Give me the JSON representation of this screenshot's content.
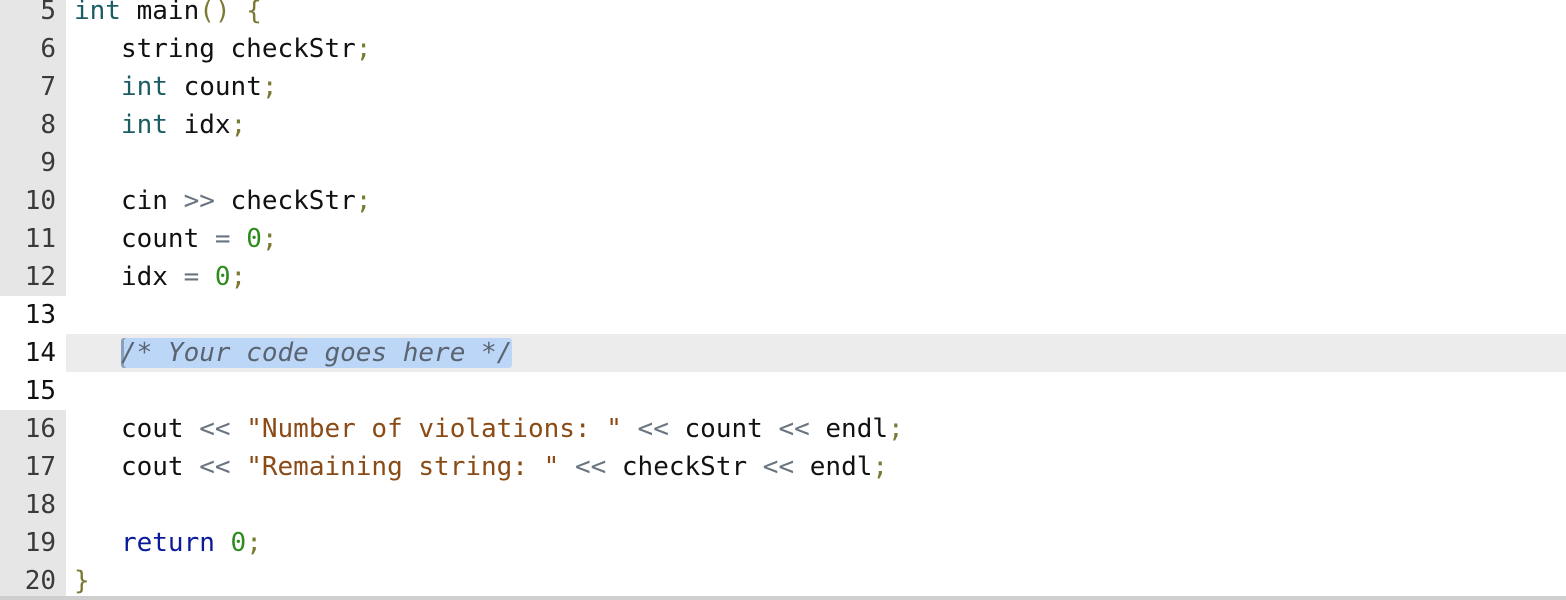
{
  "editor": {
    "lines": [
      {
        "number": "5",
        "mode": "readonly",
        "tokens": [
          {
            "t": "kw",
            "v": "int"
          },
          {
            "t": "id",
            "v": " main"
          },
          {
            "t": "punc",
            "v": "()"
          },
          {
            "t": "id",
            "v": " "
          },
          {
            "t": "punc",
            "v": "{"
          }
        ]
      },
      {
        "number": "6",
        "mode": "readonly",
        "tokens": [
          {
            "t": "id",
            "v": "   string checkStr"
          },
          {
            "t": "punc",
            "v": ";"
          }
        ]
      },
      {
        "number": "7",
        "mode": "readonly",
        "tokens": [
          {
            "t": "id",
            "v": "   "
          },
          {
            "t": "kw",
            "v": "int"
          },
          {
            "t": "id",
            "v": " count"
          },
          {
            "t": "punc",
            "v": ";"
          }
        ]
      },
      {
        "number": "8",
        "mode": "readonly",
        "tokens": [
          {
            "t": "id",
            "v": "   "
          },
          {
            "t": "kw",
            "v": "int"
          },
          {
            "t": "id",
            "v": " idx"
          },
          {
            "t": "punc",
            "v": ";"
          }
        ]
      },
      {
        "number": "9",
        "mode": "readonly",
        "tokens": []
      },
      {
        "number": "10",
        "mode": "readonly",
        "tokens": [
          {
            "t": "id",
            "v": "   cin "
          },
          {
            "t": "op",
            "v": ">>"
          },
          {
            "t": "id",
            "v": " checkStr"
          },
          {
            "t": "punc",
            "v": ";"
          }
        ]
      },
      {
        "number": "11",
        "mode": "readonly",
        "tokens": [
          {
            "t": "id",
            "v": "   count "
          },
          {
            "t": "op",
            "v": "="
          },
          {
            "t": "id",
            "v": " "
          },
          {
            "t": "num",
            "v": "0"
          },
          {
            "t": "punc",
            "v": ";"
          }
        ]
      },
      {
        "number": "12",
        "mode": "readonly",
        "tokens": [
          {
            "t": "id",
            "v": "   idx "
          },
          {
            "t": "op",
            "v": "="
          },
          {
            "t": "id",
            "v": " "
          },
          {
            "t": "num",
            "v": "0"
          },
          {
            "t": "punc",
            "v": ";"
          }
        ]
      },
      {
        "number": "13",
        "mode": "editable",
        "tokens": []
      },
      {
        "number": "14",
        "mode": "editable",
        "active": true,
        "tokens": [
          {
            "t": "id",
            "v": "   "
          },
          {
            "t": "cm",
            "v": "/* Your code goes here */"
          }
        ]
      },
      {
        "number": "15",
        "mode": "editable",
        "tokens": []
      },
      {
        "number": "16",
        "mode": "readonly",
        "tokens": [
          {
            "t": "id",
            "v": "   cout "
          },
          {
            "t": "op",
            "v": "<<"
          },
          {
            "t": "id",
            "v": " "
          },
          {
            "t": "str",
            "v": "\"Number of violations: \""
          },
          {
            "t": "id",
            "v": " "
          },
          {
            "t": "op",
            "v": "<<"
          },
          {
            "t": "id",
            "v": " count "
          },
          {
            "t": "op",
            "v": "<<"
          },
          {
            "t": "id",
            "v": " endl"
          },
          {
            "t": "punc",
            "v": ";"
          }
        ]
      },
      {
        "number": "17",
        "mode": "readonly",
        "tokens": [
          {
            "t": "id",
            "v": "   cout "
          },
          {
            "t": "op",
            "v": "<<"
          },
          {
            "t": "id",
            "v": " "
          },
          {
            "t": "str",
            "v": "\"Remaining string: \""
          },
          {
            "t": "id",
            "v": " "
          },
          {
            "t": "op",
            "v": "<<"
          },
          {
            "t": "id",
            "v": " checkStr "
          },
          {
            "t": "op",
            "v": "<<"
          },
          {
            "t": "id",
            "v": " endl"
          },
          {
            "t": "punc",
            "v": ";"
          }
        ]
      },
      {
        "number": "18",
        "mode": "readonly",
        "tokens": []
      },
      {
        "number": "19",
        "mode": "readonly",
        "tokens": [
          {
            "t": "id",
            "v": "   "
          },
          {
            "t": "ret",
            "v": "return"
          },
          {
            "t": "id",
            "v": " "
          },
          {
            "t": "num",
            "v": "0"
          },
          {
            "t": "punc",
            "v": ";"
          }
        ]
      },
      {
        "number": "20",
        "mode": "readonly",
        "tokens": [
          {
            "t": "punc",
            "v": "}"
          }
        ]
      }
    ]
  }
}
